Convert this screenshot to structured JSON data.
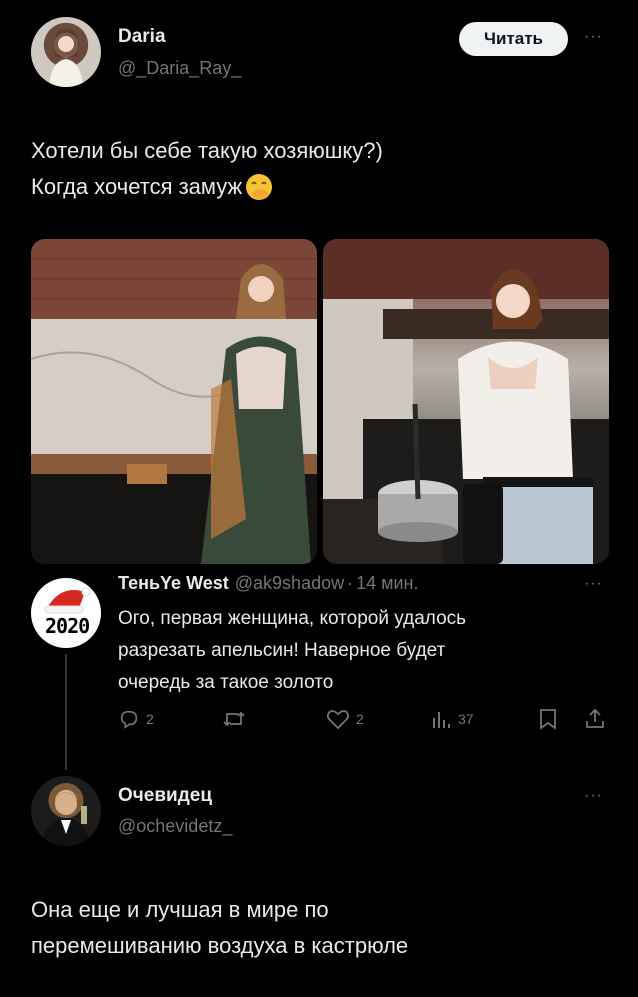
{
  "post": {
    "author_name": "Daria",
    "author_handle": "@_Daria_Ray_",
    "follow_label": "Читать",
    "more": "···",
    "text_line1": "Хотели бы себе такую хозяюшку?)",
    "text_line2": "Когда хочется замуж"
  },
  "reply1": {
    "author_name": "ТеньYe West",
    "author_handle": "@ak9shadow",
    "separator": "·",
    "time": "14 мин.",
    "more": "···",
    "avatar_text": "2020",
    "text_line1": "Ого, первая женщина, которой удалось",
    "text_line2": "разрезать апельсин! Наверное будет",
    "text_line3": "очередь за такое золото",
    "actions": {
      "replies": "2",
      "retweets": "",
      "likes": "2",
      "views": "37"
    }
  },
  "reply2": {
    "author_name": "Очевидец",
    "author_handle": "@ochevidetz_",
    "more": "···",
    "text_line1": "Она еще и лучшая в мире по",
    "text_line2": "перемешиванию воздуха в кастрюле"
  },
  "colors": {
    "background": "#000000",
    "text": "#e7e9ea",
    "secondary": "#71767b",
    "thread_line": "#333639"
  }
}
